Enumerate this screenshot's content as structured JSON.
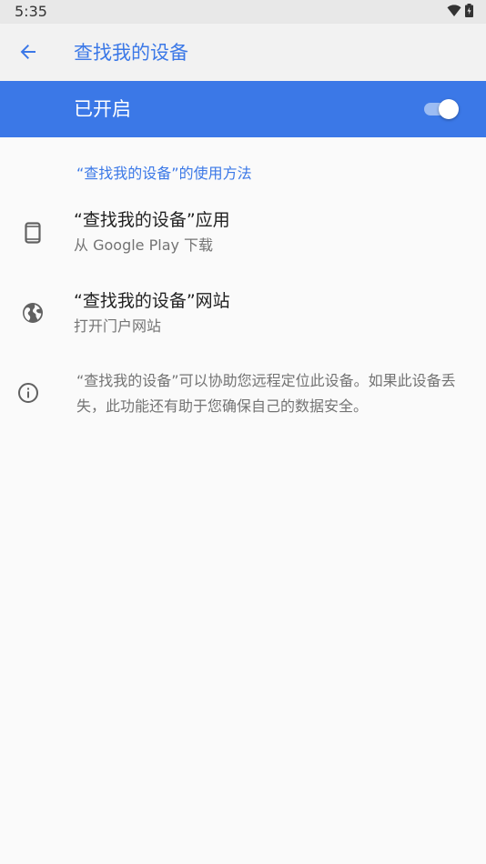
{
  "status_bar": {
    "time": "5:35",
    "icons": [
      "wifi-icon",
      "battery-charging-icon"
    ]
  },
  "app_bar": {
    "back_icon": "arrow-back-icon",
    "title": "查找我的设备",
    "accent_color": "#3b78e7"
  },
  "master_switch": {
    "label": "已开启",
    "on": true,
    "bar_color": "#3b78e7"
  },
  "section": {
    "header": "“查找我的设备”的使用方法"
  },
  "items": [
    {
      "icon": "phone-icon",
      "title": "“查找我的设备”应用",
      "subtitle": "从 Google Play 下载"
    },
    {
      "icon": "globe-icon",
      "title": "“查找我的设备”网站",
      "subtitle": "打开门户网站"
    }
  ],
  "info": {
    "icon": "info-icon",
    "text": "“查找我的设备”可以协助您远程定位此设备。如果此设备丢失，此功能还有助于您确保自己的数据安全。"
  }
}
